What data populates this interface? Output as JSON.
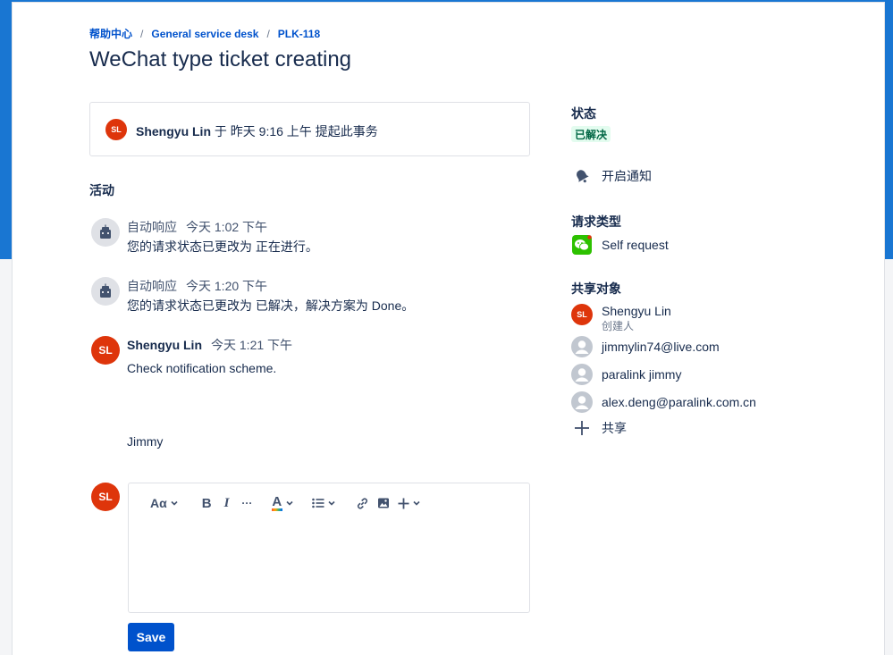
{
  "breadcrumb": {
    "home": "帮助中心",
    "desk": "General service desk",
    "issue": "PLK-118",
    "separator": "/"
  },
  "title": "WeChat type ticket creating",
  "raised": {
    "avatar_initials": "SL",
    "user": "Shengyu Lin",
    "text": " 于 昨天 9:16 上午 提起此事务"
  },
  "activity": {
    "heading": "活动",
    "items": [
      {
        "who": "自动响应",
        "when": "今天 1:02 下午",
        "body": "您的请求状态已更改为 正在进行。"
      },
      {
        "who": "自动响应",
        "when": "今天 1:20 下午",
        "body": "您的请求状态已更改为 已解决，解决方案为 Done。"
      },
      {
        "avatar_initials": "SL",
        "who": "Shengyu Lin",
        "when": "今天 1:21 下午",
        "body": "Check notification scheme.",
        "signature": "Jimmy"
      }
    ]
  },
  "editor": {
    "avatar_initials": "SL",
    "toolbar": {
      "text_style": "Aα",
      "bold": "B",
      "italic": "I",
      "more": "···",
      "text_color": "A"
    },
    "save_label": "Save"
  },
  "sidebar": {
    "status_label": "状态",
    "status_value": "已解决",
    "notify_label": "开启通知",
    "request_type_label": "请求类型",
    "request_type_value": "Self request",
    "shared_label": "共享对象",
    "participants": [
      {
        "name": "Shengyu Lin",
        "role": "创建人",
        "initials": "SL"
      },
      {
        "name": "jimmylin74@live.com"
      },
      {
        "name": "paralink jimmy"
      },
      {
        "name": "alex.deng@paralink.com.cn"
      }
    ],
    "share_label": "共享"
  },
  "colors": {
    "accent": "#0052cc",
    "avatar": "#de350b",
    "resolved_bg": "#e3fcef",
    "resolved_text": "#006644",
    "wechat": "#2dc100"
  }
}
